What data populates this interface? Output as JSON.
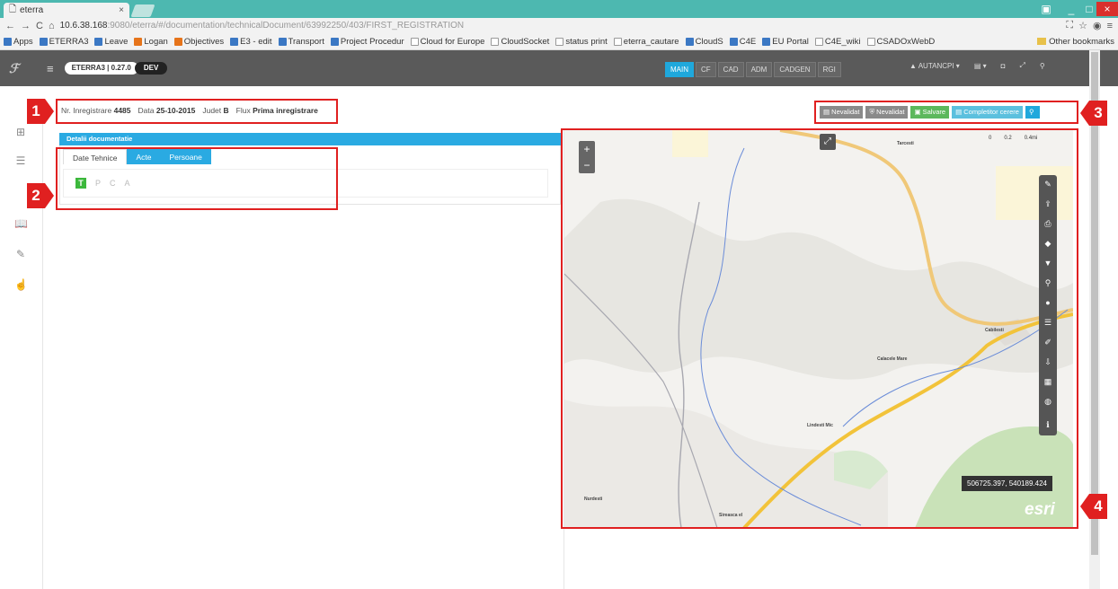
{
  "browser": {
    "tab_title": "eterra",
    "url_host": "10.6.38.168",
    "url_path": ":9080/eterra/#/documentation/technicalDocument/63992250/403/FIRST_REGISTRATION",
    "bookmarks": [
      "Apps",
      "ETERRA3",
      "Leave",
      "Logan",
      "Objectives",
      "E3 - edit",
      "Transport",
      "Project Procedur",
      "Cloud for Europe",
      "CloudSocket",
      "status print",
      "eterra_cautare",
      "CloudS",
      "C4E",
      "EU Portal",
      "C4E_wiki",
      "CSADOxWebD"
    ],
    "other_bookmarks": "Other bookmarks"
  },
  "app": {
    "version": "ETERRA3 | 0.27.0",
    "env": "DEV",
    "modules": [
      "MAIN",
      "CF",
      "CAD",
      "ADM",
      "CADGEN",
      "RGI"
    ],
    "user": "AUTANCPI"
  },
  "infobar": {
    "nr_label": "Nr. Inregistrare",
    "nr_value": "4485",
    "data_label": "Data",
    "data_value": "25-10-2015",
    "judet_label": "Judet",
    "judet_value": "B",
    "flux_label": "Flux",
    "flux_value": "Prima inregistrare"
  },
  "actions": [
    "Nevalidat",
    "Nevalidat",
    "Salvare",
    "Completitor cerere"
  ],
  "panel": {
    "title": "Detalii documentatie",
    "tabs": [
      "Date Tehnice",
      "Acte",
      "Persoane"
    ],
    "letters": [
      "T",
      "P",
      "C",
      "A"
    ]
  },
  "map": {
    "coords": "506725.397, 540189.424",
    "brand": "esri",
    "scale": [
      "0",
      "0.2",
      "0.4mi"
    ],
    "places": [
      "Tarcesti",
      "Cabilesti",
      "Calacele Mare",
      "Lindesti Mic",
      "Nurdesti",
      "Sireasca el"
    ]
  },
  "badges": [
    "1",
    "2",
    "3",
    "4"
  ]
}
